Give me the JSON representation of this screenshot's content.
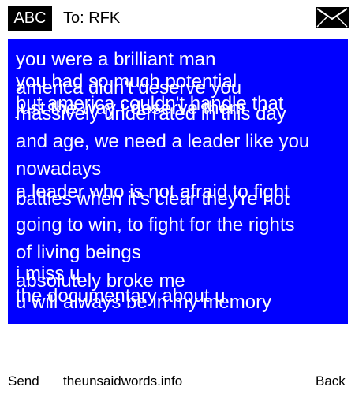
{
  "header": {
    "logo_text": "ABC",
    "to_label": "To: RFK",
    "mail_icon": "envelope-icon"
  },
  "message": {
    "lines": [
      "you were a brilliant man",
      "you had so much potential",
      "america didn't deserve you",
      "but america couldn't handle that",
      "just the way i deserve them",
      "massively underrated in this day",
      "and age, we need a leader like you",
      "nowadays",
      "a leader who is not afraid to fight",
      "battles when it's clear they're not",
      "going to win, to fight for the rights",
      "of living beings",
      "i miss u",
      "absolutely broke me",
      "the documentary about u",
      "u will always be in my memory"
    ]
  },
  "footer": {
    "send_label": "Send",
    "site_label": "theunsaidwords.info",
    "back_label": "Back"
  },
  "colors": {
    "panel_background": "#0000ff",
    "message_text": "#ffffff",
    "logo_background": "#000000"
  }
}
